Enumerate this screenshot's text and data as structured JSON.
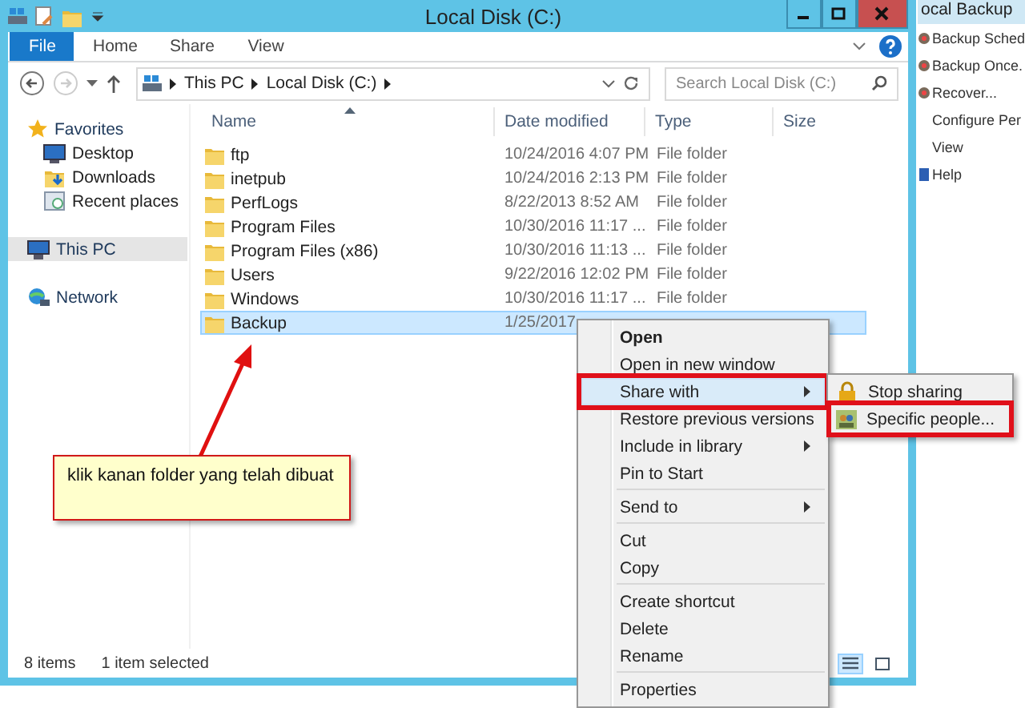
{
  "window": {
    "title": "Local Disk (C:)"
  },
  "ribbon_tabs": [
    {
      "label": "File",
      "kind": "file"
    },
    {
      "label": "Home",
      "kind": "tab"
    },
    {
      "label": "Share",
      "kind": "tab"
    },
    {
      "label": "View",
      "kind": "tab"
    }
  ],
  "address": {
    "crumbs": [
      "This PC",
      "Local Disk (C:)"
    ]
  },
  "search": {
    "placeholder": "Search Local Disk (C:)"
  },
  "nav": [
    {
      "label": "Favorites",
      "kind": "favorites",
      "selected": false,
      "children": [
        {
          "label": "Desktop",
          "kind": "desktop",
          "selected": false
        },
        {
          "label": "Downloads",
          "kind": "downloads",
          "selected": false
        },
        {
          "label": "Recent places",
          "kind": "recent",
          "selected": false
        }
      ]
    },
    {
      "label": "This PC",
      "kind": "pc",
      "selected": true
    },
    {
      "label": "Network",
      "kind": "network",
      "selected": false
    }
  ],
  "columns": [
    "Name",
    "Date modified",
    "Type",
    "Size"
  ],
  "rows": [
    {
      "name": "ftp",
      "date": "10/24/2016 4:07 PM",
      "type": "File folder",
      "selected": false
    },
    {
      "name": "inetpub",
      "date": "10/24/2016 2:13 PM",
      "type": "File folder",
      "selected": false
    },
    {
      "name": "PerfLogs",
      "date": "8/22/2013 8:52 AM",
      "type": "File folder",
      "selected": false
    },
    {
      "name": "Program Files",
      "date": "10/30/2016 11:17 ...",
      "type": "File folder",
      "selected": false
    },
    {
      "name": "Program Files (x86)",
      "date": "10/30/2016 11:13 ...",
      "type": "File folder",
      "selected": false
    },
    {
      "name": "Users",
      "date": "9/22/2016 12:02 PM",
      "type": "File folder",
      "selected": false
    },
    {
      "name": "Windows",
      "date": "10/30/2016 11:17 ...",
      "type": "File folder",
      "selected": false
    },
    {
      "name": "Backup",
      "date": "1/25/2017",
      "selected": true
    }
  ],
  "status_bar": {
    "count": "8 items",
    "selection": "1 item selected"
  },
  "context_menu": {
    "items": [
      {
        "kind": "item",
        "label": "Open",
        "bold": true,
        "submenu": false,
        "highlighted": false,
        "marked": false
      },
      {
        "kind": "item",
        "label": "Open in new window",
        "bold": false,
        "submenu": false,
        "highlighted": false,
        "marked": false
      },
      {
        "kind": "item",
        "label": "Share with",
        "bold": false,
        "submenu": true,
        "highlighted": true,
        "marked": true
      },
      {
        "kind": "item",
        "label": "Restore previous versions",
        "bold": false,
        "submenu": false,
        "highlighted": false,
        "marked": false
      },
      {
        "kind": "item",
        "label": "Include in library",
        "bold": false,
        "submenu": true,
        "highlighted": false,
        "marked": false
      },
      {
        "kind": "item",
        "label": "Pin to Start",
        "bold": false,
        "submenu": false,
        "highlighted": false,
        "marked": false
      },
      {
        "kind": "separator"
      },
      {
        "kind": "item",
        "label": "Send to",
        "bold": false,
        "submenu": true,
        "highlighted": false,
        "marked": false
      },
      {
        "kind": "separator"
      },
      {
        "kind": "item",
        "label": "Cut",
        "bold": false,
        "submenu": false,
        "highlighted": false,
        "marked": false
      },
      {
        "kind": "item",
        "label": "Copy",
        "bold": false,
        "submenu": false,
        "highlighted": false,
        "marked": false
      },
      {
        "kind": "separator"
      },
      {
        "kind": "item",
        "label": "Create shortcut",
        "bold": false,
        "submenu": false,
        "highlighted": false,
        "marked": false
      },
      {
        "kind": "item",
        "label": "Delete",
        "bold": false,
        "submenu": false,
        "highlighted": false,
        "marked": false
      },
      {
        "kind": "item",
        "label": "Rename",
        "bold": false,
        "submenu": false,
        "highlighted": false,
        "marked": false
      },
      {
        "kind": "separator"
      },
      {
        "kind": "item",
        "label": "Properties",
        "bold": false,
        "submenu": false,
        "highlighted": false,
        "marked": false
      }
    ]
  },
  "submenu": {
    "items": [
      {
        "label": "Stop sharing",
        "kind": "lock",
        "marked": false
      },
      {
        "label": "Specific people...",
        "kind": "people",
        "marked": true
      }
    ]
  },
  "callout": {
    "text": "klik kanan folder yang telah dibuat"
  },
  "side_panel": {
    "title": "ocal Backup",
    "items": [
      {
        "label": "Backup Sched",
        "kind": "action"
      },
      {
        "label": "Backup Once.",
        "kind": "action"
      },
      {
        "label": "Recover...",
        "kind": "action"
      },
      {
        "label": "Configure Per",
        "kind": "plain"
      },
      {
        "label": "View",
        "kind": "plain"
      },
      {
        "label": "Help",
        "kind": "help"
      }
    ]
  }
}
